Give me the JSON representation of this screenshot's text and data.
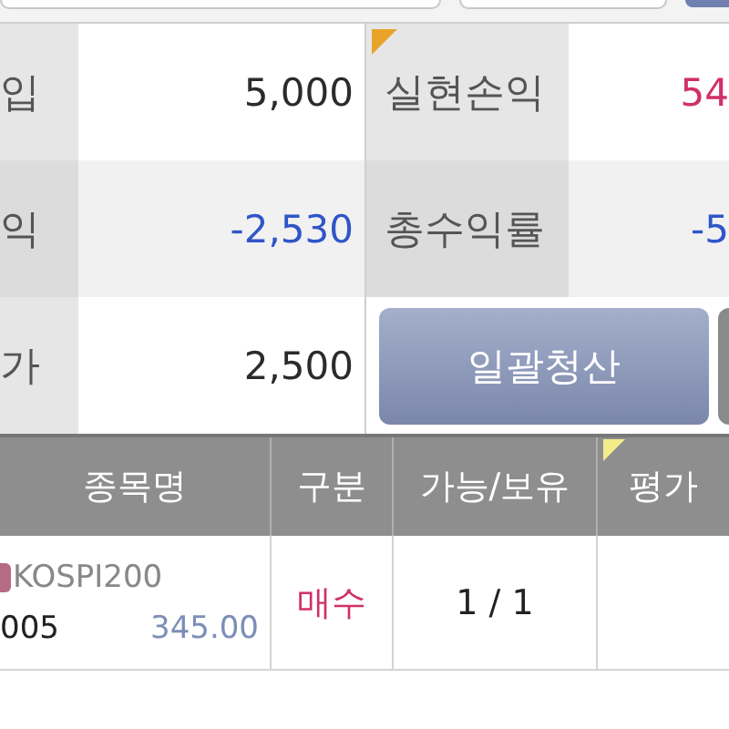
{
  "summary": {
    "rows": [
      {
        "label": "입",
        "value": "5,000",
        "color": "#2b2b2b",
        "right": {
          "kind": "stat",
          "label": "실현손익",
          "value": "54",
          "color": "#d0306a"
        }
      },
      {
        "label": "익",
        "value": "-2,530",
        "color": "#2f55c8",
        "right": {
          "kind": "stat",
          "label": "총수익률",
          "value": "-5",
          "color": "#2f55c8"
        }
      },
      {
        "label": "가",
        "value": "2,500",
        "color": "#2b2b2b",
        "right": {
          "kind": "actions",
          "button": "일괄청산"
        }
      }
    ]
  },
  "positions": {
    "columns": [
      "종목명",
      "구분",
      "가능/보유",
      "평가"
    ],
    "rows": [
      {
        "name": "KOSPI200",
        "code": "005",
        "price": "345.00",
        "side": "매수",
        "color": "#d0306a",
        "quantity": "1 / 1"
      }
    ]
  }
}
